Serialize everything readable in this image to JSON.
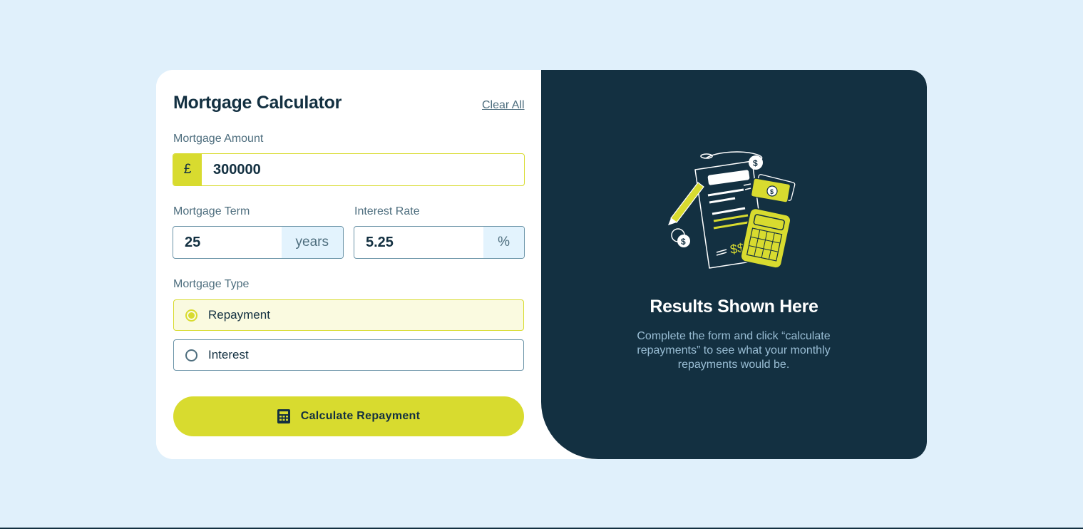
{
  "form": {
    "title": "Mortgage Calculator",
    "clear_all": "Clear All",
    "amount": {
      "label": "Mortgage Amount",
      "prefix": "£",
      "value": "300000"
    },
    "term": {
      "label": "Mortgage Term",
      "value": "25",
      "suffix": "years"
    },
    "rate": {
      "label": "Interest Rate",
      "value": "5.25",
      "suffix": "%"
    },
    "type": {
      "label": "Mortgage Type",
      "options": [
        {
          "label": "Repayment",
          "selected": true
        },
        {
          "label": "Interest",
          "selected": false
        }
      ]
    },
    "submit_label": "Calculate Repayment",
    "submit_icon": "calculator-icon"
  },
  "results": {
    "title": "Results Shown Here",
    "description": "Complete the form and click “calculate repayments” to see what your monthly repayments would be.",
    "illustration_icon": "empty-results-illustration"
  },
  "colors": {
    "background": "#e0f0fb",
    "accent": "#d8db2f",
    "dark": "#133041",
    "muted": "#4e6e7e"
  }
}
